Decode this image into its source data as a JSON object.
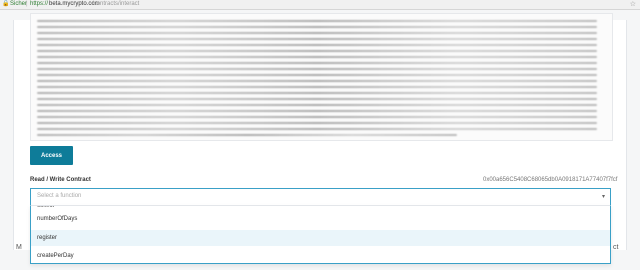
{
  "browser": {
    "secure_label": "Sicher",
    "separator": "|",
    "url_scheme": "https://",
    "url_host": "beta.mycrypto.com",
    "url_path": "/contracts/interact"
  },
  "contract": {
    "access_button": "Access",
    "read_write_label": "Read / Write Contract",
    "address": "0x00a656C5408C68065db0A0918171A77407f7fcf",
    "function_select": {
      "placeholder": "Select a function",
      "options": [
        "collect",
        "numberOfDays",
        "register",
        "createPerDay"
      ],
      "highlighted": "register"
    }
  },
  "footer": {
    "left_fragment": "M",
    "right_fragment": "ct"
  },
  "colors": {
    "accent": "#0e7c99",
    "focus_border": "#3aa0c7",
    "secure_green": "#2e7d32",
    "highlight_row": "#eaf5fa"
  },
  "icons": {
    "lock": "lock-icon",
    "star": "star-icon",
    "chevron": "chevron-down-icon"
  }
}
